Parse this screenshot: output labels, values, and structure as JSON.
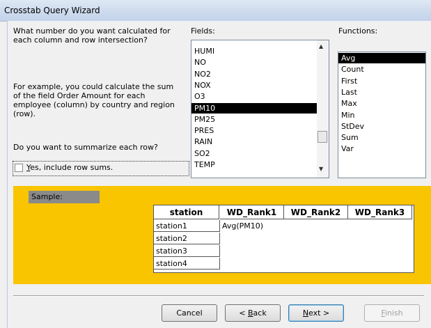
{
  "window": {
    "title": "Crosstab Query Wizard"
  },
  "prompt": {
    "question": "What number do you want calculated for\neach column and row intersection?",
    "example": "For example, you could calculate the sum\nof the field Order Amount for each\nemployee (column)  by country and region\n(row).",
    "summarize": "Do you want to summarize each row?"
  },
  "row_sums": {
    "label": "Yes, include row sums.",
    "checked": false
  },
  "fields": {
    "label": "Fields:",
    "items": [
      "HUMI",
      "NO",
      "NO2",
      "NOX",
      "O3",
      "PM10",
      "PM25",
      "PRES",
      "RAIN",
      "SO2",
      "TEMP"
    ],
    "selected": "PM10"
  },
  "functions": {
    "label": "Functions:",
    "items": [
      "Avg",
      "Count",
      "First",
      "Last",
      "Max",
      "Min",
      "StDev",
      "Sum",
      "Var"
    ],
    "selected": "Avg"
  },
  "sample": {
    "label": "Sample:",
    "row_header": "station",
    "columns": [
      "WD_Rank1",
      "WD_Rank2",
      "WD_Rank3"
    ],
    "rows": [
      "station1",
      "station2",
      "station3",
      "station4"
    ],
    "value": "Avg(PM10)"
  },
  "buttons": {
    "cancel": "Cancel",
    "back": "< Back",
    "next": "Next >",
    "finish": "Finish"
  }
}
